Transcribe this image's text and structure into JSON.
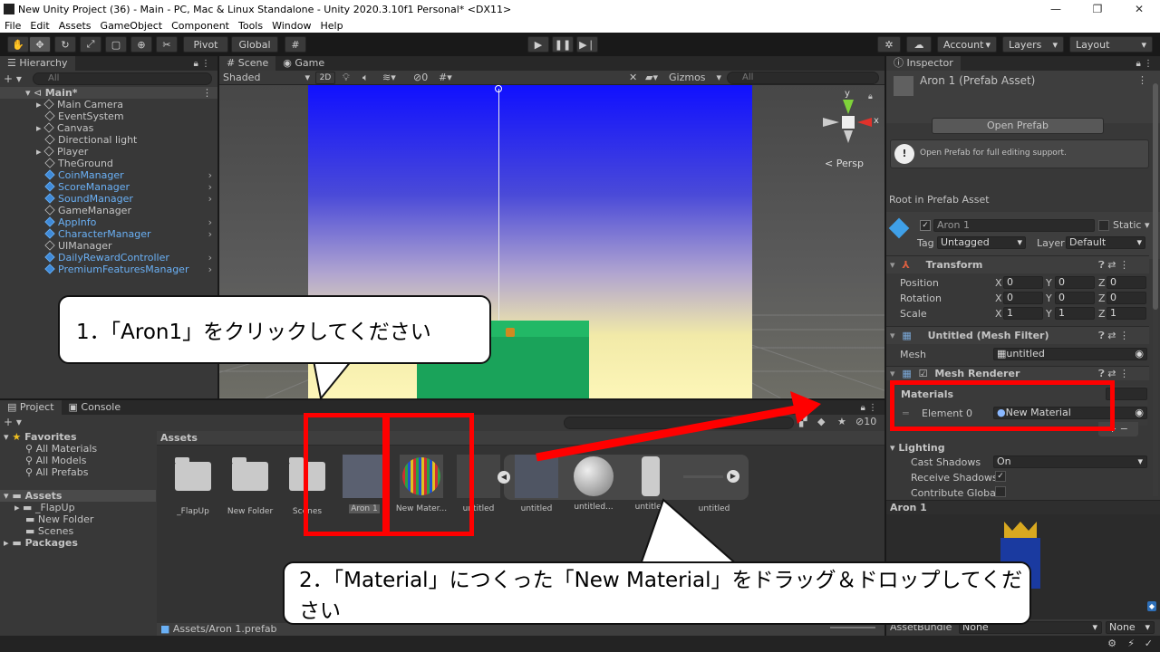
{
  "window": {
    "title": "New Unity Project (36) - Main - PC, Mac & Linux Standalone - Unity 2020.3.10f1 Personal* <DX11>",
    "minimize": "—",
    "maximize": "❐",
    "close": "✕"
  },
  "menu": [
    "File",
    "Edit",
    "Assets",
    "GameObject",
    "Component",
    "Tools",
    "Window",
    "Help"
  ],
  "toolbar": {
    "pivot": "Pivot",
    "global": "Global",
    "account": "Account",
    "layers": "Layers",
    "layout": "Layout"
  },
  "hierarchy": {
    "tab": "Hierarchy",
    "search_placeholder": "All",
    "scene": "Main*",
    "items": [
      {
        "label": "Main Camera",
        "prefab": false
      },
      {
        "label": "EventSystem",
        "prefab": false
      },
      {
        "label": "Canvas",
        "prefab": false
      },
      {
        "label": "Directional light",
        "prefab": false
      },
      {
        "label": "Player",
        "prefab": false
      },
      {
        "label": "TheGround",
        "prefab": false
      },
      {
        "label": "CoinManager",
        "prefab": true
      },
      {
        "label": "ScoreManager",
        "prefab": true
      },
      {
        "label": "SoundManager",
        "prefab": true
      },
      {
        "label": "GameManager",
        "prefab": false
      },
      {
        "label": "AppInfo",
        "prefab": true
      },
      {
        "label": "CharacterManager",
        "prefab": true
      },
      {
        "label": "UIManager",
        "prefab": false
      },
      {
        "label": "DailyRewardController",
        "prefab": true
      },
      {
        "label": "PremiumFeaturesManager",
        "prefab": true
      }
    ]
  },
  "scene_view": {
    "tab_scene": "Scene",
    "tab_game": "Game",
    "shading": "Shaded",
    "mode_2d": "2D",
    "hidden_count": "0",
    "gizmos": "Gizmos",
    "search_placeholder": "All",
    "persp": "Persp",
    "axis_y": "y",
    "axis_x": "x"
  },
  "project": {
    "tab_project": "Project",
    "tab_console": "Console",
    "favorites": "Favorites",
    "fav_items": [
      "All Materials",
      "All Models",
      "All Prefabs"
    ],
    "assets_root": "Assets",
    "asset_folders": [
      "_FlapUp",
      "New Folder",
      "Scenes"
    ],
    "packages": "Packages",
    "breadcrumb": "Assets",
    "count": "10",
    "assets": [
      "_FlapUp",
      "New Folder",
      "Scenes",
      "Aron 1",
      "New Mater...",
      "untitled",
      "untitled",
      "untitled...",
      "untitled",
      "untitled"
    ],
    "status_path": "Assets/Aron 1.prefab"
  },
  "inspector": {
    "tab": "Inspector",
    "asset_title": "Aron 1 (Prefab Asset)",
    "open_prefab": "Open Prefab",
    "info": "Open Prefab for full editing support.",
    "root_label": "Root in Prefab Asset",
    "object_name": "Aron 1",
    "static_label": "Static",
    "tag_label": "Tag",
    "tag_value": "Untagged",
    "layer_label": "Layer",
    "layer_value": "Default",
    "transform": {
      "title": "Transform",
      "position": "Position",
      "rotation": "Rotation",
      "scale": "Scale",
      "pos": [
        "0",
        "0",
        "0"
      ],
      "rot": [
        "0",
        "0",
        "0"
      ],
      "scl": [
        "1",
        "1",
        "1"
      ]
    },
    "mesh_filter": {
      "title": "Untitled (Mesh Filter)",
      "mesh_label": "Mesh",
      "mesh_value": "untitled"
    },
    "mesh_renderer": {
      "title": "Mesh Renderer"
    },
    "materials": {
      "label": "Materials",
      "size": "1",
      "element_label": "Element 0",
      "element_value": "New Material"
    },
    "lighting": {
      "title": "Lighting",
      "cast_label": "Cast Shadows",
      "cast_value": "On",
      "receive_label": "Receive Shadows",
      "contribute_label": "Contribute Global I"
    },
    "preview_title": "Aron 1",
    "assetbundle_label": "AssetBundle",
    "assetbundle_value": "None",
    "assetbundle_variant": "None"
  },
  "annotations": {
    "step1": "1．「Aron1」をクリックしてください",
    "step2": "2．「Material」につくった「New Material」をドラッグ＆ドロップしてください"
  },
  "colors": {
    "accent_red": "#ff0000",
    "prefab_blue": "#6ab0f5",
    "sky_top": "#1010ff",
    "ground_green": "#1aa35a"
  }
}
